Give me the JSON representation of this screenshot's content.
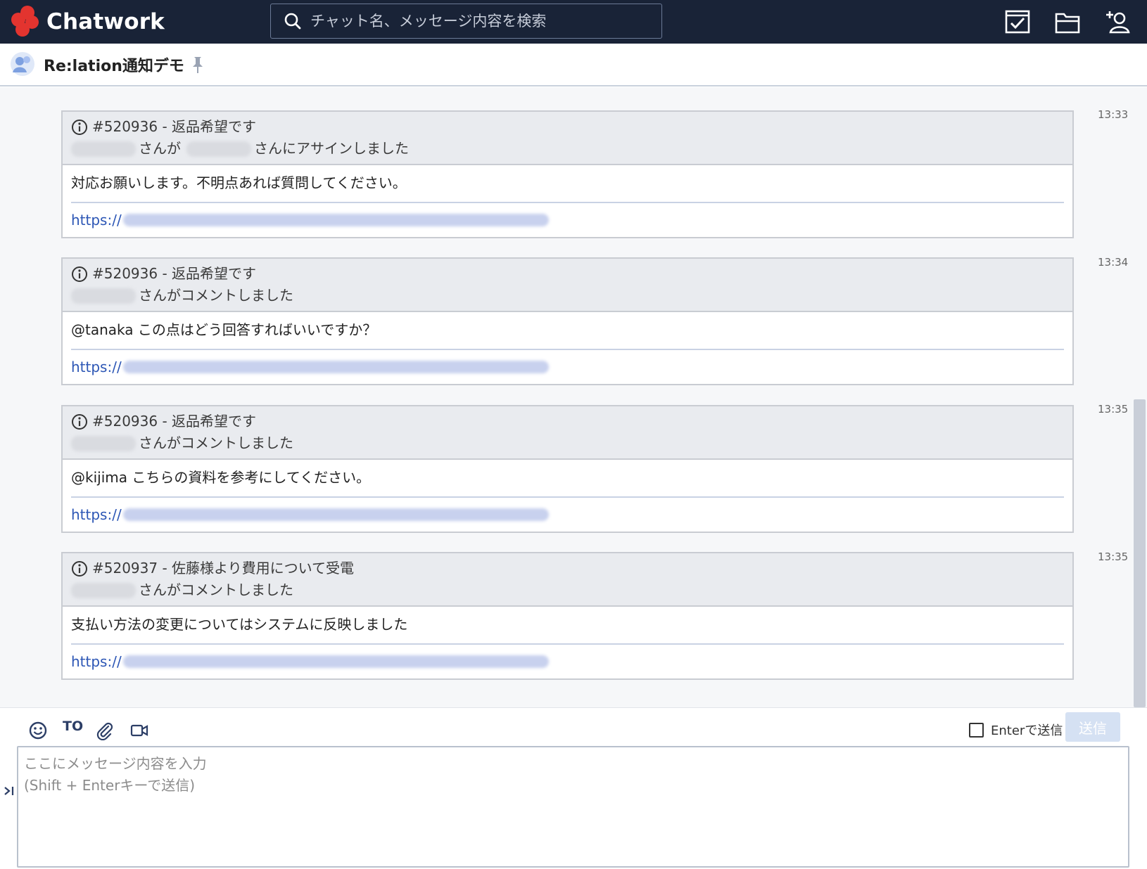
{
  "app": {
    "name": "Chatwork",
    "search_placeholder": "チャット名、メッセージ内容を検索",
    "icons": [
      "task-icon",
      "file-icon",
      "contact-add-icon"
    ]
  },
  "room": {
    "title": "Re:lation通知デモ"
  },
  "messages": [
    {
      "ticket": "#520936 - 返品希望です",
      "action": "さんが",
      "action2": "さんにアサインしました",
      "has_second_name": true,
      "body": "対応お願いします。不明点あれば質問してください。",
      "link_prefix": "https://",
      "time": "13:33"
    },
    {
      "ticket": "#520936 - 返品希望です",
      "action": "さんがコメントしました",
      "has_second_name": false,
      "body": "@tanaka この点はどう回答すればいいですか？",
      "link_prefix": "https://",
      "time": "13:34"
    },
    {
      "ticket": "#520936 - 返品希望です",
      "action": "さんがコメントしました",
      "has_second_name": false,
      "body": "@kijima こちらの資料を参考にしてください。",
      "link_prefix": "https://",
      "time": "13:35"
    },
    {
      "ticket": "#520937 - 佐藤様より費用について受電",
      "action": "さんがコメントしました",
      "has_second_name": false,
      "body": "支払い方法の変更についてはシステムに反映しました",
      "link_prefix": "https://",
      "time": "13:35"
    }
  ],
  "composer": {
    "to_label": "TO",
    "enter_send_label": "Enterで送信",
    "enter_send_checked": false,
    "send_label": "送信",
    "placeholder": "ここにメッセージ内容を入力\n(Shift + Enterキーで送信)"
  }
}
